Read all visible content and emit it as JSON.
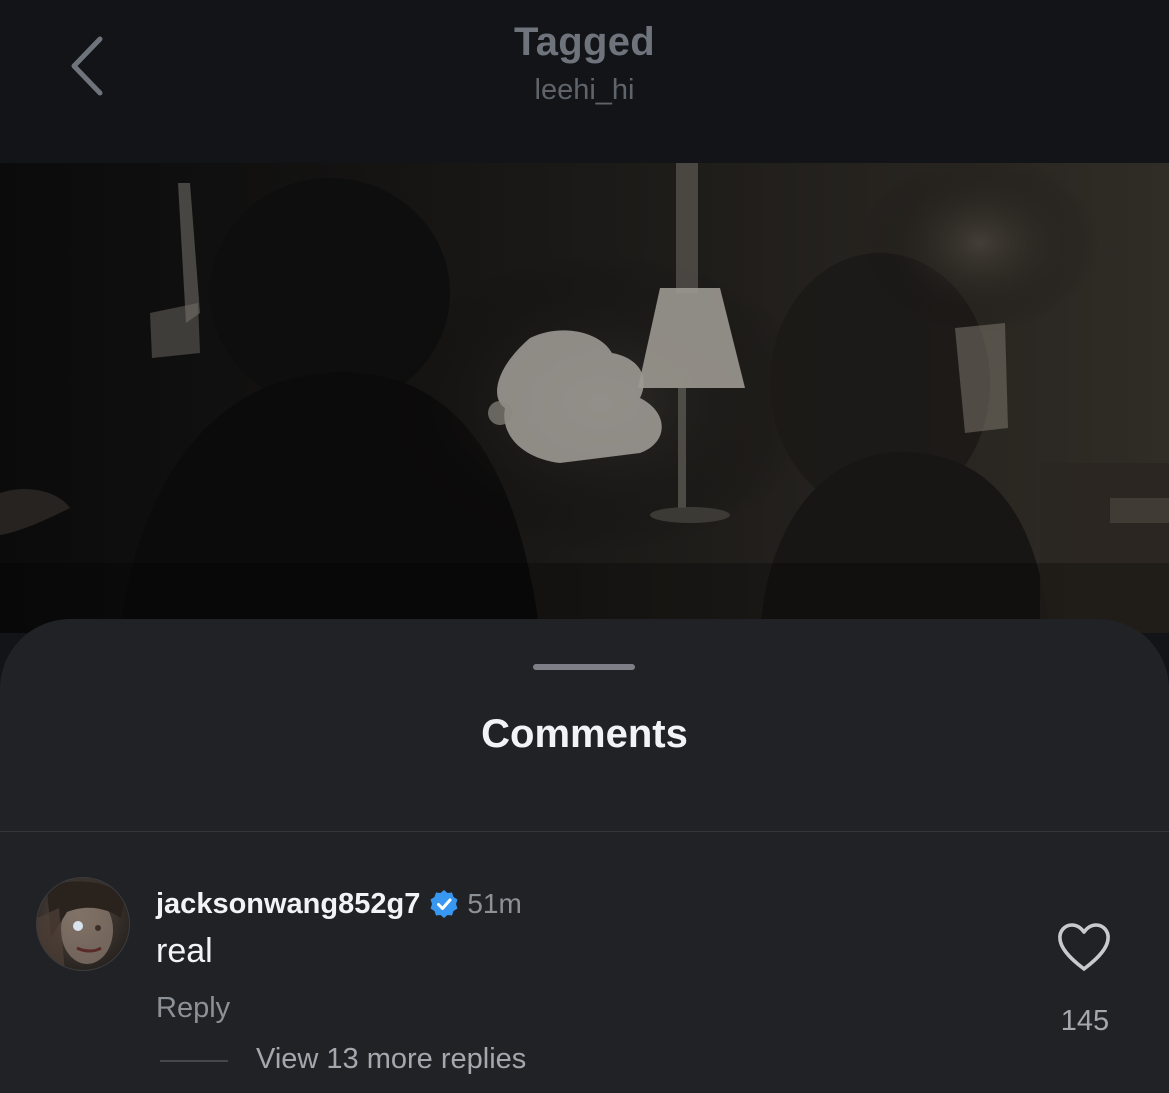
{
  "header": {
    "title": "Tagged",
    "subtitle": "leehi_hi",
    "back_icon": "chevron-left-icon"
  },
  "comments_sheet": {
    "title": "Comments",
    "comment": {
      "username": "jacksonwang852g7",
      "verified_icon": "verified-badge-icon",
      "timestamp": "51m",
      "text": "real",
      "reply_label": "Reply",
      "view_replies_label": "View 13 more replies",
      "like_icon": "heart-outline-icon",
      "like_count": "145"
    }
  },
  "colors": {
    "background": "#121418",
    "sheet": "#212226",
    "verified": "#3897f0",
    "primary_text": "#f2f3f5",
    "secondary_text": "#8c9097"
  }
}
